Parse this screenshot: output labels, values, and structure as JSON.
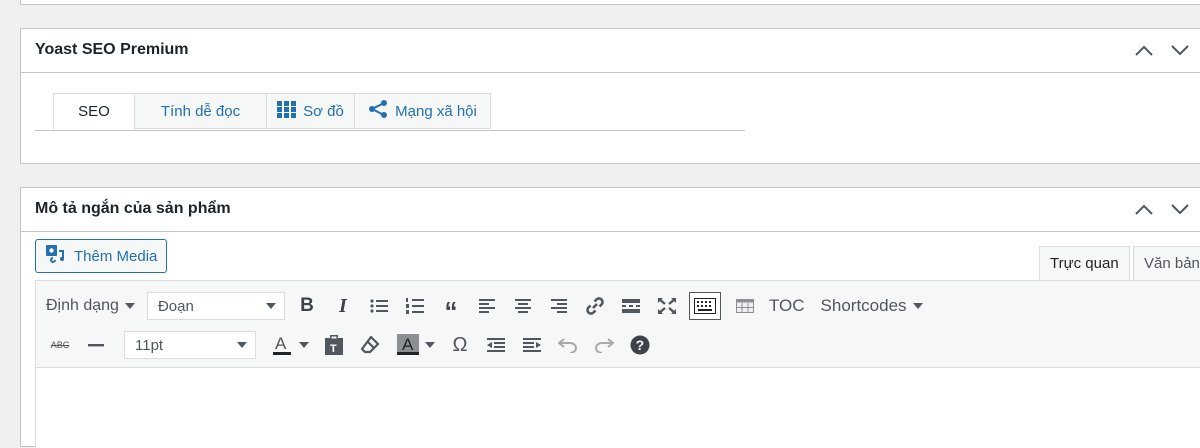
{
  "yoast": {
    "title": "Yoast SEO Premium",
    "tabs": [
      {
        "label": "SEO",
        "icon": "none"
      },
      {
        "label": "Tính dễ đọc",
        "icon": "none"
      },
      {
        "label": "Sơ đồ",
        "icon": "grid-icon"
      },
      {
        "label": "Mạng xã hội",
        "icon": "share-icon"
      }
    ]
  },
  "short_description": {
    "title": "Mô tả ngắn của sản phẩm",
    "add_media_label": "Thêm Media",
    "editor_tabs": {
      "visual": "Trực quan",
      "text": "Văn bản"
    },
    "toolbar1": {
      "format_menu": "Định dạng",
      "block_format": "Đoạn",
      "toc": "TOC",
      "shortcodes": "Shortcodes"
    },
    "toolbar2": {
      "font_size": "11pt"
    }
  },
  "colors": {
    "accent": "#2271b1",
    "text": "#1d2327",
    "icon": "#50575e"
  }
}
